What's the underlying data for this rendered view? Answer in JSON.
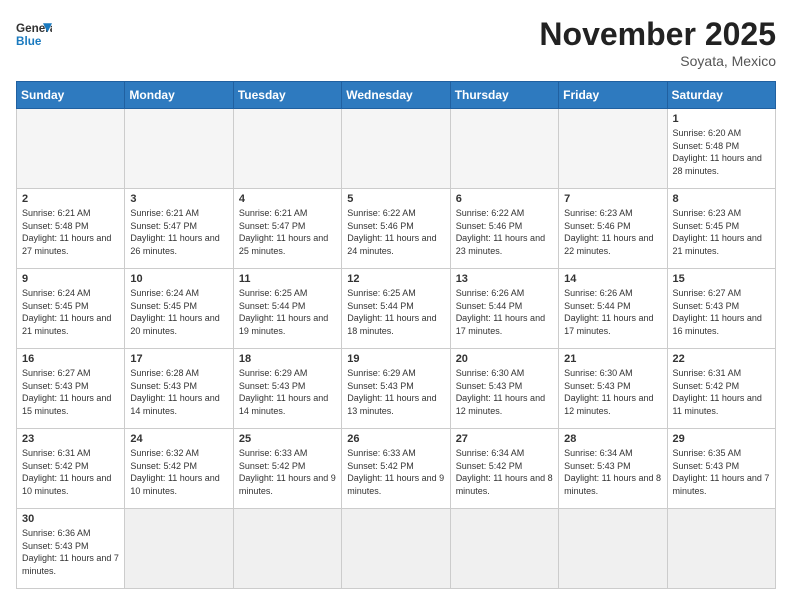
{
  "header": {
    "logo_general": "General",
    "logo_blue": "Blue",
    "month_title": "November 2025",
    "subtitle": "Soyata, Mexico"
  },
  "days_of_week": [
    "Sunday",
    "Monday",
    "Tuesday",
    "Wednesday",
    "Thursday",
    "Friday",
    "Saturday"
  ],
  "weeks": [
    [
      {
        "day": "",
        "empty": true
      },
      {
        "day": "",
        "empty": true
      },
      {
        "day": "",
        "empty": true
      },
      {
        "day": "",
        "empty": true
      },
      {
        "day": "",
        "empty": true
      },
      {
        "day": "",
        "empty": true
      },
      {
        "day": "1",
        "sunrise": "6:20 AM",
        "sunset": "5:48 PM",
        "daylight": "11 hours and 28 minutes."
      }
    ],
    [
      {
        "day": "2",
        "sunrise": "6:21 AM",
        "sunset": "5:48 PM",
        "daylight": "11 hours and 27 minutes."
      },
      {
        "day": "3",
        "sunrise": "6:21 AM",
        "sunset": "5:47 PM",
        "daylight": "11 hours and 26 minutes."
      },
      {
        "day": "4",
        "sunrise": "6:21 AM",
        "sunset": "5:47 PM",
        "daylight": "11 hours and 25 minutes."
      },
      {
        "day": "5",
        "sunrise": "6:22 AM",
        "sunset": "5:46 PM",
        "daylight": "11 hours and 24 minutes."
      },
      {
        "day": "6",
        "sunrise": "6:22 AM",
        "sunset": "5:46 PM",
        "daylight": "11 hours and 23 minutes."
      },
      {
        "day": "7",
        "sunrise": "6:23 AM",
        "sunset": "5:46 PM",
        "daylight": "11 hours and 22 minutes."
      },
      {
        "day": "8",
        "sunrise": "6:23 AM",
        "sunset": "5:45 PM",
        "daylight": "11 hours and 21 minutes."
      }
    ],
    [
      {
        "day": "9",
        "sunrise": "6:24 AM",
        "sunset": "5:45 PM",
        "daylight": "11 hours and 21 minutes."
      },
      {
        "day": "10",
        "sunrise": "6:24 AM",
        "sunset": "5:45 PM",
        "daylight": "11 hours and 20 minutes."
      },
      {
        "day": "11",
        "sunrise": "6:25 AM",
        "sunset": "5:44 PM",
        "daylight": "11 hours and 19 minutes."
      },
      {
        "day": "12",
        "sunrise": "6:25 AM",
        "sunset": "5:44 PM",
        "daylight": "11 hours and 18 minutes."
      },
      {
        "day": "13",
        "sunrise": "6:26 AM",
        "sunset": "5:44 PM",
        "daylight": "11 hours and 17 minutes."
      },
      {
        "day": "14",
        "sunrise": "6:26 AM",
        "sunset": "5:44 PM",
        "daylight": "11 hours and 17 minutes."
      },
      {
        "day": "15",
        "sunrise": "6:27 AM",
        "sunset": "5:43 PM",
        "daylight": "11 hours and 16 minutes."
      }
    ],
    [
      {
        "day": "16",
        "sunrise": "6:27 AM",
        "sunset": "5:43 PM",
        "daylight": "11 hours and 15 minutes."
      },
      {
        "day": "17",
        "sunrise": "6:28 AM",
        "sunset": "5:43 PM",
        "daylight": "11 hours and 14 minutes."
      },
      {
        "day": "18",
        "sunrise": "6:29 AM",
        "sunset": "5:43 PM",
        "daylight": "11 hours and 14 minutes."
      },
      {
        "day": "19",
        "sunrise": "6:29 AM",
        "sunset": "5:43 PM",
        "daylight": "11 hours and 13 minutes."
      },
      {
        "day": "20",
        "sunrise": "6:30 AM",
        "sunset": "5:43 PM",
        "daylight": "11 hours and 12 minutes."
      },
      {
        "day": "21",
        "sunrise": "6:30 AM",
        "sunset": "5:43 PM",
        "daylight": "11 hours and 12 minutes."
      },
      {
        "day": "22",
        "sunrise": "6:31 AM",
        "sunset": "5:42 PM",
        "daylight": "11 hours and 11 minutes."
      }
    ],
    [
      {
        "day": "23",
        "sunrise": "6:31 AM",
        "sunset": "5:42 PM",
        "daylight": "11 hours and 10 minutes."
      },
      {
        "day": "24",
        "sunrise": "6:32 AM",
        "sunset": "5:42 PM",
        "daylight": "11 hours and 10 minutes."
      },
      {
        "day": "25",
        "sunrise": "6:33 AM",
        "sunset": "5:42 PM",
        "daylight": "11 hours and 9 minutes."
      },
      {
        "day": "26",
        "sunrise": "6:33 AM",
        "sunset": "5:42 PM",
        "daylight": "11 hours and 9 minutes."
      },
      {
        "day": "27",
        "sunrise": "6:34 AM",
        "sunset": "5:42 PM",
        "daylight": "11 hours and 8 minutes."
      },
      {
        "day": "28",
        "sunrise": "6:34 AM",
        "sunset": "5:43 PM",
        "daylight": "11 hours and 8 minutes."
      },
      {
        "day": "29",
        "sunrise": "6:35 AM",
        "sunset": "5:43 PM",
        "daylight": "11 hours and 7 minutes."
      }
    ],
    [
      {
        "day": "30",
        "sunrise": "6:36 AM",
        "sunset": "5:43 PM",
        "daylight": "11 hours and 7 minutes."
      },
      {
        "day": "",
        "empty": true
      },
      {
        "day": "",
        "empty": true
      },
      {
        "day": "",
        "empty": true
      },
      {
        "day": "",
        "empty": true
      },
      {
        "day": "",
        "empty": true
      },
      {
        "day": "",
        "empty": true
      }
    ]
  ]
}
